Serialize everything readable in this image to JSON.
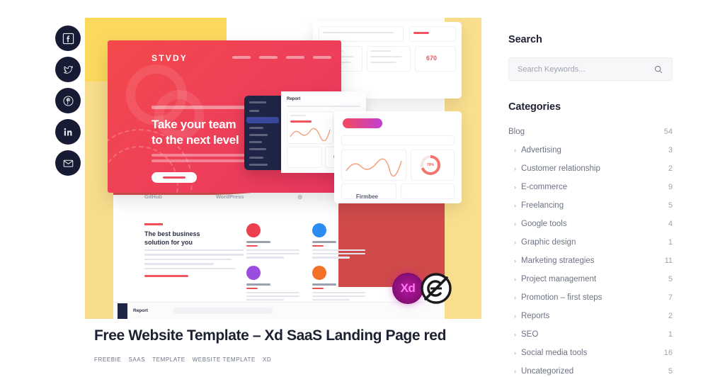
{
  "share": {
    "items": [
      {
        "name": "facebook",
        "icon": "facebook-icon"
      },
      {
        "name": "twitter",
        "icon": "twitter-icon"
      },
      {
        "name": "pinterest",
        "icon": "pinterest-icon"
      },
      {
        "name": "linkedin",
        "icon": "linkedin-icon"
      },
      {
        "name": "email",
        "icon": "email-icon"
      }
    ]
  },
  "featured_image": {
    "hero": {
      "brand": "STVDY",
      "title": "Take your team\nto the next level"
    },
    "logos": [
      "GitHub",
      "WordPress",
      "instagram",
      "Firmbee"
    ],
    "section": {
      "heading": "The best business\nsolution for you"
    },
    "browser_title": "Report",
    "badges": {
      "xd": "Xd",
      "copyright_free": "copyright-free"
    }
  },
  "post": {
    "title": "Free Website Template – Xd SaaS Landing Page red",
    "tags": [
      "FREEBIE",
      "SAAS",
      "TEMPLATE",
      "WEBSITE TEMPLATE",
      "XD"
    ]
  },
  "sidebar": {
    "search": {
      "heading": "Search",
      "placeholder": "Search Keywords...",
      "value": ""
    },
    "categories": {
      "heading": "Categories",
      "items": [
        {
          "label": "Blog",
          "count": "54",
          "child": false
        },
        {
          "label": "Advertising",
          "count": "3",
          "child": true
        },
        {
          "label": "Customer relationship",
          "count": "2",
          "child": true
        },
        {
          "label": "E-commerce",
          "count": "9",
          "child": true
        },
        {
          "label": "Freelancing",
          "count": "5",
          "child": true
        },
        {
          "label": "Google tools",
          "count": "4",
          "child": true
        },
        {
          "label": "Graphic design",
          "count": "1",
          "child": true
        },
        {
          "label": "Marketing strategies",
          "count": "11",
          "child": true
        },
        {
          "label": "Project management",
          "count": "5",
          "child": true
        },
        {
          "label": "Promotion – first steps",
          "count": "7",
          "child": true
        },
        {
          "label": "Reports",
          "count": "2",
          "child": true
        },
        {
          "label": "SEO",
          "count": "1",
          "child": true
        },
        {
          "label": "Social media tools",
          "count": "16",
          "child": true
        },
        {
          "label": "Uncategorized",
          "count": "5",
          "child": true
        }
      ]
    }
  },
  "colors": {
    "dark": "#171b33",
    "accent_red": "#ef4a5d",
    "yellow": "#f9de8e",
    "muted": "#9ea3b0"
  }
}
